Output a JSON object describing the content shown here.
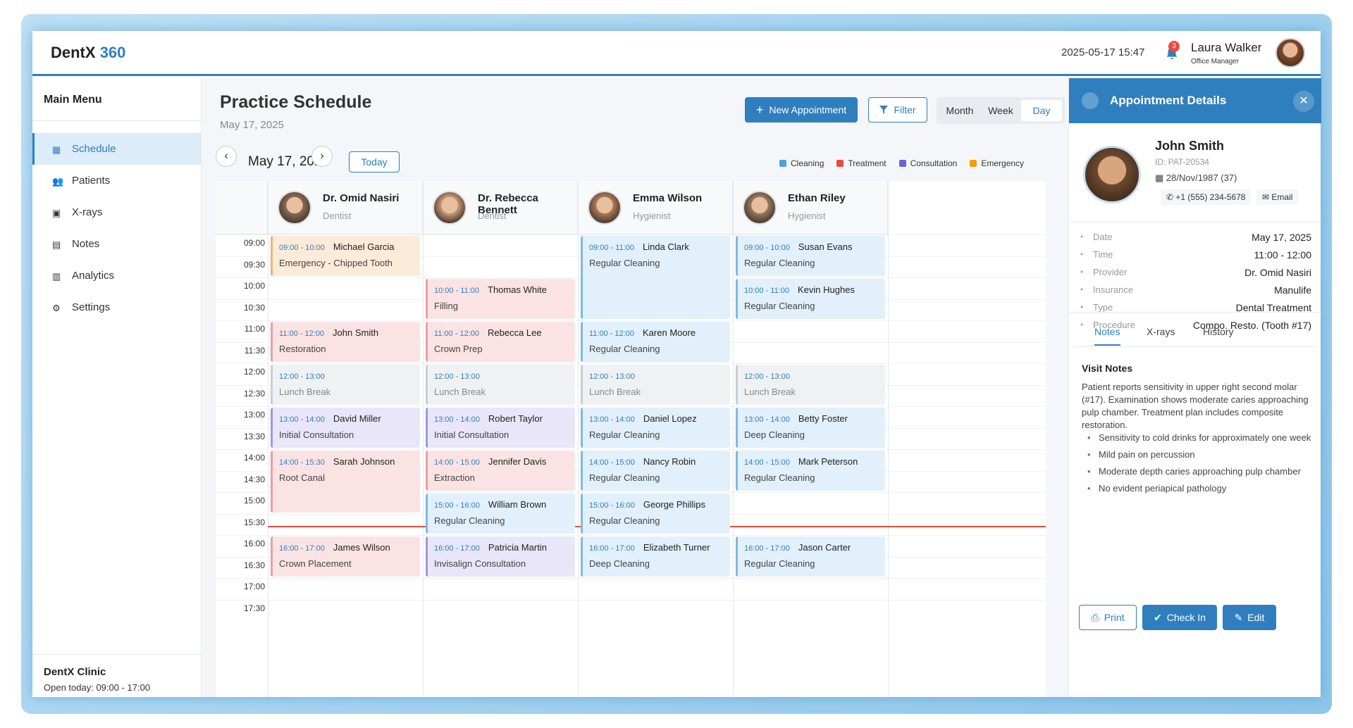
{
  "app": {
    "name_a": "DentX",
    "name_b": "360"
  },
  "header": {
    "datetime": "2025-05-17 15:47",
    "notification_count": "3",
    "user_name": "Laura Walker",
    "user_role": "Office Manager"
  },
  "sidebar": {
    "title": "Main Menu",
    "items": [
      {
        "label": "Schedule",
        "icon": "calendar-icon",
        "active": true
      },
      {
        "label": "Patients",
        "icon": "users-icon"
      },
      {
        "label": "X-rays",
        "icon": "image-icon"
      },
      {
        "label": "Notes",
        "icon": "file-icon"
      },
      {
        "label": "Analytics",
        "icon": "chart-icon"
      },
      {
        "label": "Settings",
        "icon": "gear-icon"
      }
    ],
    "clinic_name": "DentX Clinic",
    "clinic_hours": "Open today: 09:00 - 17:00"
  },
  "schedule": {
    "title": "Practice Schedule",
    "subtitle": "May 17, 2025",
    "new_appointment": "New Appointment",
    "filter": "Filter",
    "views": [
      "Month",
      "Week",
      "Day"
    ],
    "active_view": "Day",
    "current_date": "May 17, 2025",
    "today": "Today",
    "legend": [
      {
        "label": "Cleaning",
        "color": "#4aa3df"
      },
      {
        "label": "Treatment",
        "color": "#e74c3c"
      },
      {
        "label": "Consultation",
        "color": "#6c63d8"
      },
      {
        "label": "Emergency",
        "color": "#f39c12"
      }
    ],
    "times": [
      "09:00",
      "09:30",
      "10:00",
      "10:30",
      "11:00",
      "11:30",
      "12:00",
      "12:30",
      "13:00",
      "13:30",
      "14:00",
      "14:30",
      "15:00",
      "15:30",
      "16:00",
      "16:30",
      "17:00",
      "17:30"
    ],
    "providers": [
      {
        "name": "Dr. Omid Nasiri",
        "role": "Dentist"
      },
      {
        "name": "Dr. Rebecca Bennett",
        "role": "Dentist"
      },
      {
        "name": "Emma Wilson",
        "role": "Hygienist"
      },
      {
        "name": "Ethan Riley",
        "role": "Hygienist"
      }
    ],
    "appointments": [
      {
        "col": 0,
        "start": 9,
        "end": 10,
        "time": "09:00 - 10:00",
        "patient": "Michael Garcia",
        "desc": "Emergency - Chipped Tooth",
        "kind": "em"
      },
      {
        "col": 0,
        "start": 11,
        "end": 12,
        "time": "11:00 - 12:00",
        "patient": "John Smith",
        "desc": "Restoration",
        "kind": "tr"
      },
      {
        "col": 0,
        "start": 12,
        "end": 13,
        "time": "12:00 - 13:00",
        "patient": "",
        "desc": "Lunch Break",
        "kind": "lb"
      },
      {
        "col": 0,
        "start": 13,
        "end": 14,
        "time": "13:00 - 14:00",
        "patient": "David Miller",
        "desc": "Initial Consultation",
        "kind": "co"
      },
      {
        "col": 0,
        "start": 14,
        "end": 15.5,
        "time": "14:00 - 15:30",
        "patient": "Sarah Johnson",
        "desc": "Root Canal",
        "kind": "tr"
      },
      {
        "col": 0,
        "start": 16,
        "end": 17,
        "time": "16:00 - 17:00",
        "patient": "James Wilson",
        "desc": "Crown Placement",
        "kind": "tr"
      },
      {
        "col": 1,
        "start": 10,
        "end": 11,
        "time": "10:00 - 11:00",
        "patient": "Thomas White",
        "desc": "Filling",
        "kind": "tr"
      },
      {
        "col": 1,
        "start": 11,
        "end": 12,
        "time": "11:00 - 12:00",
        "patient": "Rebecca Lee",
        "desc": "Crown Prep",
        "kind": "tr"
      },
      {
        "col": 1,
        "start": 12,
        "end": 13,
        "time": "12:00 - 13:00",
        "patient": "",
        "desc": "Lunch Break",
        "kind": "lb"
      },
      {
        "col": 1,
        "start": 13,
        "end": 14,
        "time": "13:00 - 14:00",
        "patient": "Robert Taylor",
        "desc": "Initial Consultation",
        "kind": "co"
      },
      {
        "col": 1,
        "start": 14,
        "end": 15,
        "time": "14:00 - 15:00",
        "patient": "Jennifer Davis",
        "desc": "Extraction",
        "kind": "tr"
      },
      {
        "col": 1,
        "start": 15,
        "end": 16,
        "time": "15:00 - 16:00",
        "patient": "William Brown",
        "desc": "Regular Cleaning",
        "kind": "cl"
      },
      {
        "col": 1,
        "start": 16,
        "end": 17,
        "time": "16:00 - 17:00",
        "patient": "Patricia Martin",
        "desc": "Invisalign Consultation",
        "kind": "co"
      },
      {
        "col": 2,
        "start": 9,
        "end": 11,
        "time": "09:00 - 11:00",
        "patient": "Linda Clark",
        "desc": "Regular Cleaning",
        "kind": "cl"
      },
      {
        "col": 2,
        "start": 11,
        "end": 12,
        "time": "11:00 - 12:00",
        "patient": "Karen Moore",
        "desc": "Regular Cleaning",
        "kind": "cl"
      },
      {
        "col": 2,
        "start": 12,
        "end": 13,
        "time": "12:00 - 13:00",
        "patient": "",
        "desc": "Lunch Break",
        "kind": "lb"
      },
      {
        "col": 2,
        "start": 13,
        "end": 14,
        "time": "13:00 - 14:00",
        "patient": "Daniel Lopez",
        "desc": "Regular Cleaning",
        "kind": "cl"
      },
      {
        "col": 2,
        "start": 14,
        "end": 15,
        "time": "14:00 - 15:00",
        "patient": "Nancy Robin",
        "desc": "Regular Cleaning",
        "kind": "cl"
      },
      {
        "col": 2,
        "start": 15,
        "end": 16,
        "time": "15:00 - 16:00",
        "patient": "George Phillips",
        "desc": "Regular Cleaning",
        "kind": "cl"
      },
      {
        "col": 2,
        "start": 16,
        "end": 17,
        "time": "16:00 - 17:00",
        "patient": "Elizabeth Turner",
        "desc": "Deep Cleaning",
        "kind": "cl"
      },
      {
        "col": 3,
        "start": 9,
        "end": 10,
        "time": "09:00 - 10:00",
        "patient": "Susan Evans",
        "desc": "Regular Cleaning",
        "kind": "cl"
      },
      {
        "col": 3,
        "start": 10,
        "end": 11,
        "time": "10:00 - 11:00",
        "patient": "Kevin Hughes",
        "desc": "Regular Cleaning",
        "kind": "cl"
      },
      {
        "col": 3,
        "start": 12,
        "end": 13,
        "time": "12:00 - 13:00",
        "patient": "",
        "desc": "Lunch Break",
        "kind": "lb"
      },
      {
        "col": 3,
        "start": 13,
        "end": 14,
        "time": "13:00 - 14:00",
        "patient": "Betty Foster",
        "desc": "Deep Cleaning",
        "kind": "cl"
      },
      {
        "col": 3,
        "start": 14,
        "end": 15,
        "time": "14:00 - 15:00",
        "patient": "Mark Peterson",
        "desc": "Regular Cleaning",
        "kind": "cl"
      },
      {
        "col": 3,
        "start": 16,
        "end": 17,
        "time": "16:00 - 17:00",
        "patient": "Jason Carter",
        "desc": "Regular Cleaning",
        "kind": "cl"
      }
    ]
  },
  "details": {
    "title": "Appointment Details",
    "patient_name": "John Smith",
    "patient_id": "ID: PAT-20534",
    "dob": "28/Nov/1987 (37)",
    "phone": "+1 (555) 234-5678",
    "email": "Email",
    "fields": [
      {
        "key": "Date",
        "value": "May 17, 2025"
      },
      {
        "key": "Time",
        "value": "11:00 - 12:00"
      },
      {
        "key": "Provider",
        "value": "Dr. Omid Nasiri"
      },
      {
        "key": "Insurance",
        "value": "Manulife"
      },
      {
        "key": "Type",
        "value": "Dental Treatment"
      },
      {
        "key": "Procedure",
        "value": "Compo. Resto. (Tooth #17)"
      }
    ],
    "tabs": [
      "Notes",
      "X-rays",
      "History"
    ],
    "notes_title": "Visit Notes",
    "notes_text": "Patient reports sensitivity in upper right second molar (#17). Examination shows moderate caries approaching pulp chamber. Treatment plan includes composite restoration.",
    "notes_list": [
      "Sensitivity to cold drinks for approximately one week",
      "Mild pain on percussion",
      "Moderate depth caries approaching pulp chamber",
      "No evident periapical pathology"
    ],
    "print": "Print",
    "check_in": "Check In",
    "edit": "Edit"
  }
}
